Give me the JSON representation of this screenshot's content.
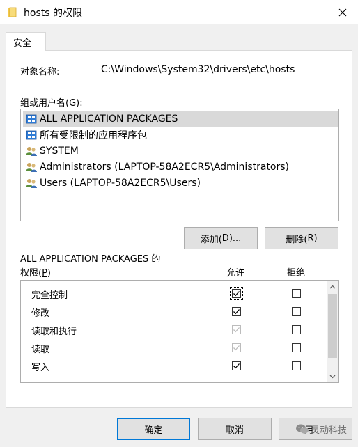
{
  "window": {
    "title": "hosts 的权限",
    "folder_icon": "folder-icon",
    "close_icon": "close-icon"
  },
  "tab": {
    "label": "安全"
  },
  "object": {
    "label": "对象名称:",
    "value": "C:\\Windows\\System32\\drivers\\etc\\hosts"
  },
  "groups": {
    "label_prefix": "组或用户名(",
    "label_key": "G",
    "label_suffix": "):",
    "items": [
      {
        "name": "ALL APPLICATION PACKAGES",
        "icon": "app-package-icon",
        "selected": true
      },
      {
        "name": "所有受限制的应用程序包",
        "icon": "app-package-icon",
        "selected": false
      },
      {
        "name": "SYSTEM",
        "icon": "user-group-icon",
        "selected": false
      },
      {
        "name": "Administrators (LAPTOP-58A2ECR5\\Administrators)",
        "icon": "user-group-icon",
        "selected": false
      },
      {
        "name": "Users (LAPTOP-58A2ECR5\\Users)",
        "icon": "user-group-icon",
        "selected": false
      }
    ]
  },
  "buttons": {
    "add_prefix": "添加(",
    "add_key": "D",
    "add_suffix": ")...",
    "remove_prefix": "删除(",
    "remove_key": "R",
    "remove_suffix": ")",
    "ok": "确定",
    "cancel": "取消",
    "apply_partial": "用"
  },
  "permissions": {
    "title": "ALL APPLICATION PACKAGES 的",
    "label_prefix": "权限(",
    "label_key": "P",
    "label_suffix": ")",
    "allow_header": "允许",
    "deny_header": "拒绝",
    "rows": [
      {
        "name": "完全控制",
        "allow": "checked",
        "deny": "unchecked"
      },
      {
        "name": "修改",
        "allow": "checked",
        "deny": "unchecked"
      },
      {
        "name": "读取和执行",
        "allow": "disabled-checked",
        "deny": "unchecked"
      },
      {
        "name": "读取",
        "allow": "disabled-checked",
        "deny": "unchecked"
      },
      {
        "name": "写入",
        "allow": "checked",
        "deny": "unchecked"
      }
    ]
  },
  "watermark": {
    "text": "灵动科技",
    "icon": "wechat-icon"
  }
}
